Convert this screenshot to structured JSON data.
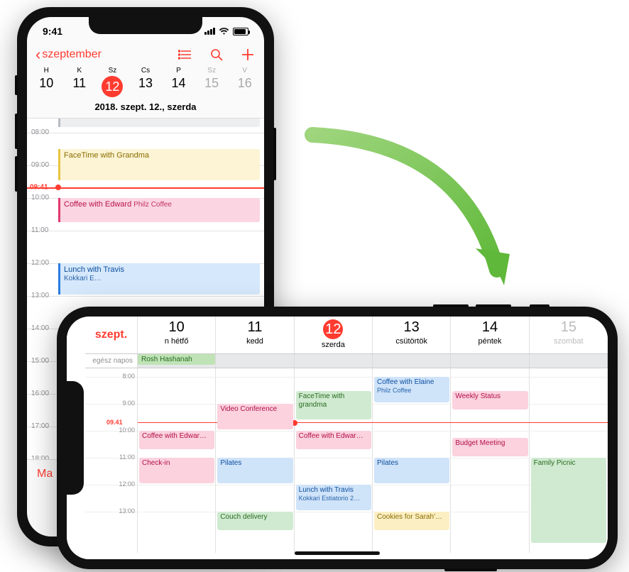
{
  "status": {
    "time": "9:41"
  },
  "portrait": {
    "back_label": "szeptember",
    "full_date": "2018. szept. 12., szerda",
    "week_letters": [
      "H",
      "K",
      "Sz",
      "Cs",
      "P",
      "Sz",
      "V"
    ],
    "week_nums": [
      "10",
      "11",
      "12",
      "13",
      "14",
      "15",
      "16"
    ],
    "weekend_indices": [
      5,
      6
    ],
    "selected_index": 2,
    "hours": [
      "08:00",
      "09:00",
      "10:00",
      "11:00",
      "12:00",
      "13:00",
      "14:00",
      "15:00",
      "16:00",
      "17:00",
      "18:00"
    ],
    "now_label": "09:41",
    "events": {
      "ev0": {
        "title": "FaceTime with Grandma",
        "sub": ""
      },
      "ev1": {
        "title": "Coffee with Edward",
        "sub": "Philz Coffee"
      },
      "ev2": {
        "title": "Lunch with Travis",
        "sub": "Kokkari E…"
      }
    },
    "today_label": "Ma"
  },
  "landscape": {
    "month_label": "szept.",
    "days": [
      {
        "num": "10",
        "name": "n hétfő"
      },
      {
        "num": "11",
        "name": "kedd"
      },
      {
        "num": "12",
        "name": "szerda"
      },
      {
        "num": "13",
        "name": "csütörtök"
      },
      {
        "num": "14",
        "name": "péntek"
      },
      {
        "num": "15",
        "name": "szombat"
      }
    ],
    "selected_index": 2,
    "weekend_indices": [
      5
    ],
    "allday_label": "egész napos",
    "allday_events": {
      "0": "Rosh Hashanah"
    },
    "hours": [
      "8:00",
      "9:00",
      "10:00",
      "11:00",
      "12:00",
      "13:00"
    ],
    "now_label": "09.41",
    "events": {
      "e0": {
        "title": "Coffee with Edwar…"
      },
      "e1": {
        "title": "Check-in"
      },
      "e2": {
        "title": "Video Conference"
      },
      "e3": {
        "title": "Pilates"
      },
      "e4": {
        "title": "Couch delivery"
      },
      "e5": {
        "title": "FaceTime with grandma"
      },
      "e6": {
        "title": "Coffee with Edwar…"
      },
      "e7": {
        "title": "Lunch with Travis",
        "sub": "Kokkari Estiatorio 2…"
      },
      "e8": {
        "title": "Coffee with Elaine",
        "sub": "Philz Coffee"
      },
      "e9": {
        "title": "Pilates"
      },
      "e10": {
        "title": "Cookies for Sarah'…"
      },
      "e11": {
        "title": "Weekly Status"
      },
      "e12": {
        "title": "Budget Meeting"
      },
      "e13": {
        "title": "Family Picnic"
      }
    }
  }
}
